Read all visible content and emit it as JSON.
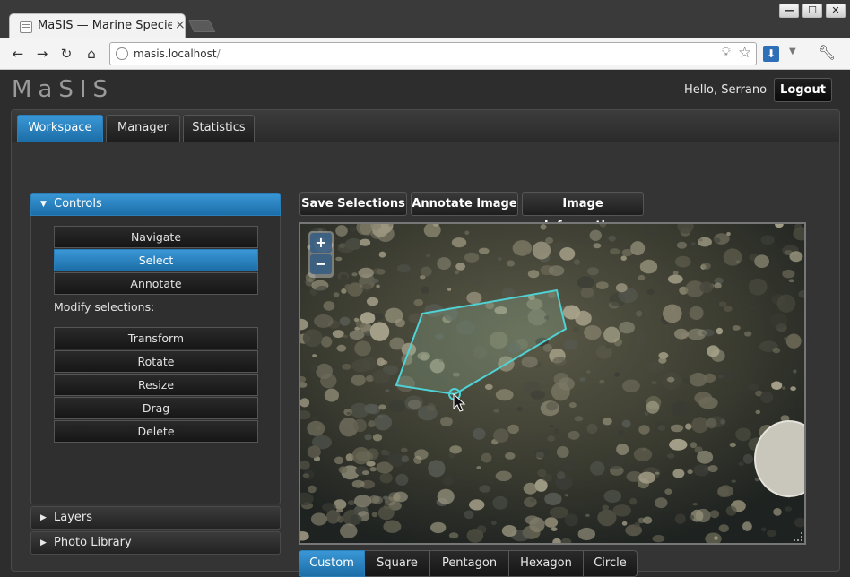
{
  "browser": {
    "tab_title": "MaSIS — Marine Species",
    "tab_close": "×",
    "url_host": "masis.localhost",
    "url_path": "/",
    "window_buttons": {
      "minimize": "—",
      "maximize": "☐",
      "close": "✕"
    },
    "nav": {
      "back": "←",
      "forward": "→",
      "reload": "↻",
      "home": "⌂"
    }
  },
  "app": {
    "logo": "MaSIS",
    "greeting": "Hello, Serrano",
    "logout_label": "Logout",
    "tabs": [
      {
        "label": "Workspace",
        "active": true
      },
      {
        "label": "Manager",
        "active": false
      },
      {
        "label": "Statistics",
        "active": false
      }
    ]
  },
  "sidebar": {
    "controls_title": "Controls",
    "modes": [
      {
        "label": "Navigate",
        "active": false
      },
      {
        "label": "Select",
        "active": true
      },
      {
        "label": "Annotate",
        "active": false
      }
    ],
    "modify_label": "Modify selections:",
    "modify_actions": [
      "Transform",
      "Rotate",
      "Resize",
      "Drag",
      "Delete"
    ],
    "layers_title": "Layers",
    "photo_library_title": "Photo Library"
  },
  "workspace": {
    "actions": [
      "Save Selections",
      "Annotate Image",
      "Image Information"
    ],
    "zoom_in": "+",
    "zoom_out": "−",
    "shapes": [
      {
        "label": "Custom",
        "active": true
      },
      {
        "label": "Square",
        "active": false
      },
      {
        "label": "Pentagon",
        "active": false
      },
      {
        "label": "Hexagon",
        "active": false
      },
      {
        "label": "Circle",
        "active": false
      }
    ]
  },
  "colors": {
    "accent": "#2a82c4",
    "selection_outline": "#4fd2d4",
    "background": "#2d2d2d"
  }
}
